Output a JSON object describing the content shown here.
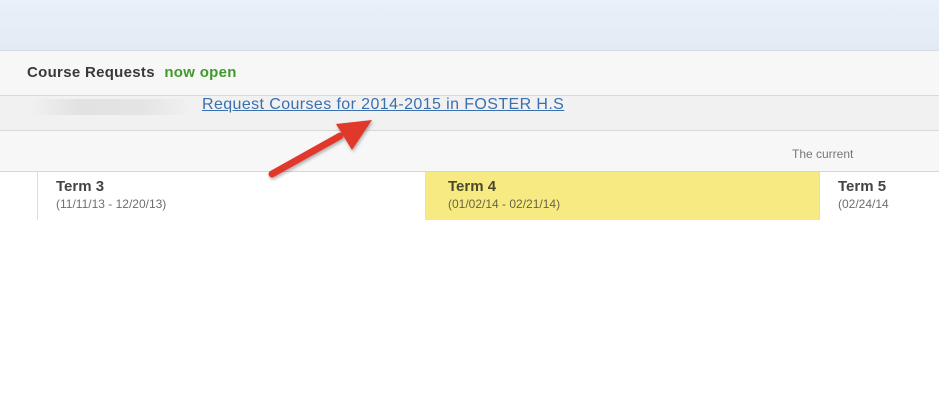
{
  "course_requests": {
    "label": "Course Requests",
    "status": "now open"
  },
  "request_link": {
    "text": "Request Courses for 2014-2015 in FOSTER H.S"
  },
  "current_notice": {
    "text": "The current"
  },
  "terms": [
    {
      "name": "Term 3",
      "dates": "(11/11/13 - 12/20/13)"
    },
    {
      "name": "Term 4",
      "dates": "(01/02/14 - 02/21/14)"
    },
    {
      "name": "Term 5",
      "dates": "(02/24/14"
    }
  ],
  "colors": {
    "status_green": "#3f9a2a",
    "link_blue": "#3a6fb0",
    "current_term_highlight": "#f7ea82",
    "arrow_red": "#e0382a"
  },
  "annotations": {
    "arrow_icon": "red-arrow-icon"
  }
}
